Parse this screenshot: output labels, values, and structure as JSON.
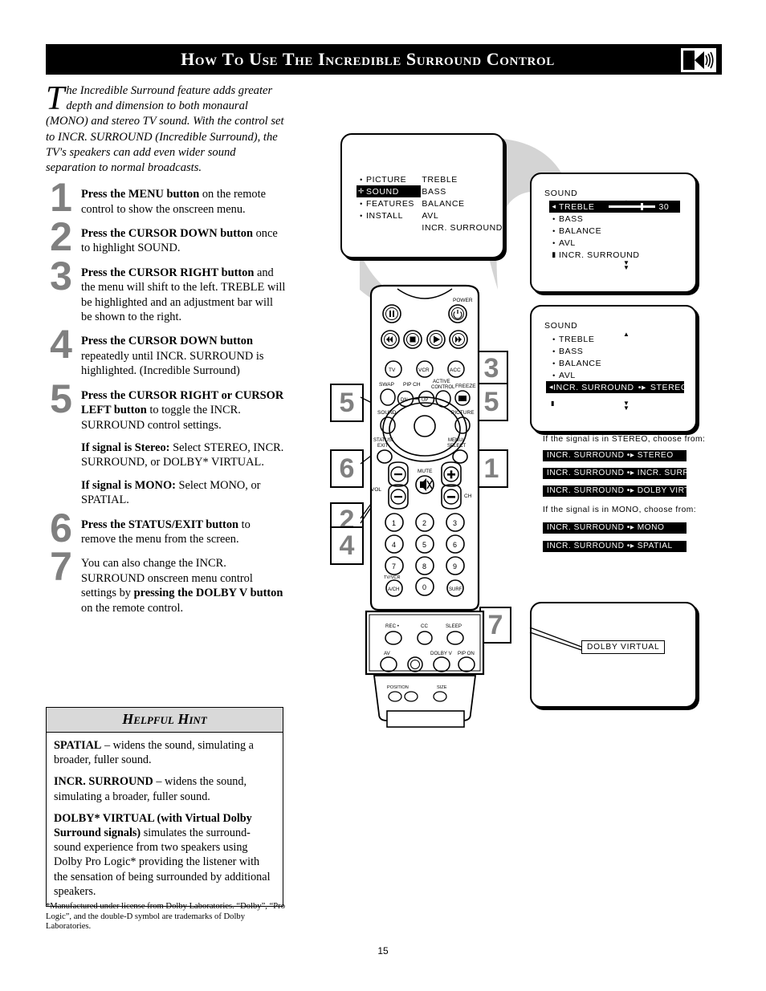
{
  "header": {
    "title": "How to Use the Incredible Surround Control",
    "icon": "speaker-icon"
  },
  "intro": {
    "dropcap": "T",
    "text": "he Incredible Surround feature adds greater depth and dimension to both monaural (MONO) and stereo TV sound.  With the control set to INCR. SURROUND (Incredible Surround), the TV's speakers can add even wider sound separation to normal broadcasts."
  },
  "steps": [
    {
      "num": "1",
      "bold": "Press the MENU button",
      "rest": " on the remote control to show the onscreen menu."
    },
    {
      "num": "2",
      "bold": "Press the CURSOR DOWN button",
      "rest": " once to highlight SOUND."
    },
    {
      "num": "3",
      "bold": "Press the CURSOR RIGHT button",
      "rest": " and the menu will shift to the left. TREBLE will be highlighted and an adjustment bar will be shown to the right."
    },
    {
      "num": "4",
      "bold": "Press the CURSOR DOWN button",
      "rest": " repeatedly until INCR. SURROUND is highlighted. (Incredible Surround)"
    },
    {
      "num": "5",
      "bold": "Press the CURSOR RIGHT or CURSOR LEFT button",
      "rest": " to toggle the INCR. SURROUND control settings.",
      "extra1_bold": "If signal is Stereo:",
      "extra1_rest": " Select STEREO, INCR. SURROUND, or DOLBY* VIRTUAL.",
      "extra2_bold": "If signal is MONO:",
      "extra2_rest": " Select MONO, or SPATIAL."
    },
    {
      "num": "6",
      "bold": "Press the STATUS/EXIT button",
      "rest": " to remove the menu from the screen."
    },
    {
      "num": "7",
      "bold": "",
      "rest": "You can also change the INCR. SURROUND onscreen menu control settings by ",
      "bold2": "pressing the DOLBY V button",
      "rest2": " on the remote control."
    }
  ],
  "hint": {
    "title": "Helpful Hint",
    "items": [
      {
        "bold": "SPATIAL",
        "rest": " – widens the sound, simulating a broader, fuller sound."
      },
      {
        "bold": "INCR. SURROUND",
        "rest": " – widens the sound, simulating a broader, fuller sound."
      },
      {
        "bold": "DOLBY* VIRTUAL (with Virtual Dolby Surround signals)",
        "rest": " simulates the surround-sound experience from two speakers using Dolby Pro Logic* providing the listener with the sensation of being surrounded by additional speakers."
      }
    ]
  },
  "footnote": "*Manufactured under license from Dolby Laboratories. “Dolby”, “Pro Logic”, and the double-D symbol are trademarks of Dolby Laboratories.",
  "page_number": "15",
  "screen1": {
    "left_items": [
      "PICTURE",
      "SOUND",
      "FEATURES",
      "INSTALL"
    ],
    "highlighted": "SOUND",
    "right_items": [
      "TREBLE",
      "BASS",
      "BALANCE",
      "AVL",
      "INCR. SURROUND"
    ]
  },
  "screen2": {
    "title": "SOUND",
    "items": [
      "TREBLE",
      "BASS",
      "BALANCE",
      "AVL",
      "INCR. SURROUND"
    ],
    "highlighted": "TREBLE",
    "value": "30"
  },
  "screen3": {
    "title": "SOUND",
    "items": [
      "TREBLE",
      "BASS",
      "BALANCE",
      "AVL",
      "INCR. SURROUND"
    ],
    "highlighted": "INCR. SURROUND",
    "highlighted_value": "STEREO"
  },
  "options": {
    "stereo_label": "If the signal is in STEREO, choose from:",
    "stereo_bars": [
      "INCR. SURROUND  •▸ STEREO",
      "INCR. SURROUND  •▸ INCR. SURROUND",
      "INCR. SURROUND  •▸ DOLBY VIRTUAL"
    ],
    "mono_label": "If the signal is in MONO, choose from:",
    "mono_bars": [
      "INCR. SURROUND  •▸ MONO",
      "INCR. SURROUND  •▸ SPATIAL"
    ]
  },
  "screen4": {
    "tag": "DOLBY VIRTUAL"
  },
  "callouts": [
    "5",
    "3",
    "5",
    "6",
    "1",
    "2",
    "4",
    "7"
  ],
  "remote": {
    "labels": {
      "power": "POWER",
      "tv": "TV",
      "vcr": "VCR",
      "acc": "ACC",
      "swap": "SWAP",
      "pip_ch": "PIP CH",
      "dn": "DN",
      "up": "UP",
      "active_control": "ACTIVE CONTROL",
      "freeze": "FREEZE",
      "sound": "SOUND",
      "picture": "PICTURE",
      "status_exit": "STATUS/ EXIT",
      "menu_select": "MENU/ SELECT",
      "mute": "MUTE",
      "vol": "VOL",
      "ch": "CH",
      "tv_vcr": "TV/VCR",
      "a_ch": "A/CH",
      "surf": "SURF",
      "rec": "REC •",
      "cc": "CC",
      "sleep": "SLEEP",
      "av": "AV",
      "dolby_v": "DOLBY V",
      "pip_on": "PIP ON"
    },
    "keypad": [
      "1",
      "2",
      "3",
      "4",
      "5",
      "6",
      "7",
      "8",
      "9",
      "0"
    ]
  },
  "colors": {
    "callout_num": "#808080",
    "hint_header": "#d9d9d9",
    "header_bg": "#000000"
  }
}
